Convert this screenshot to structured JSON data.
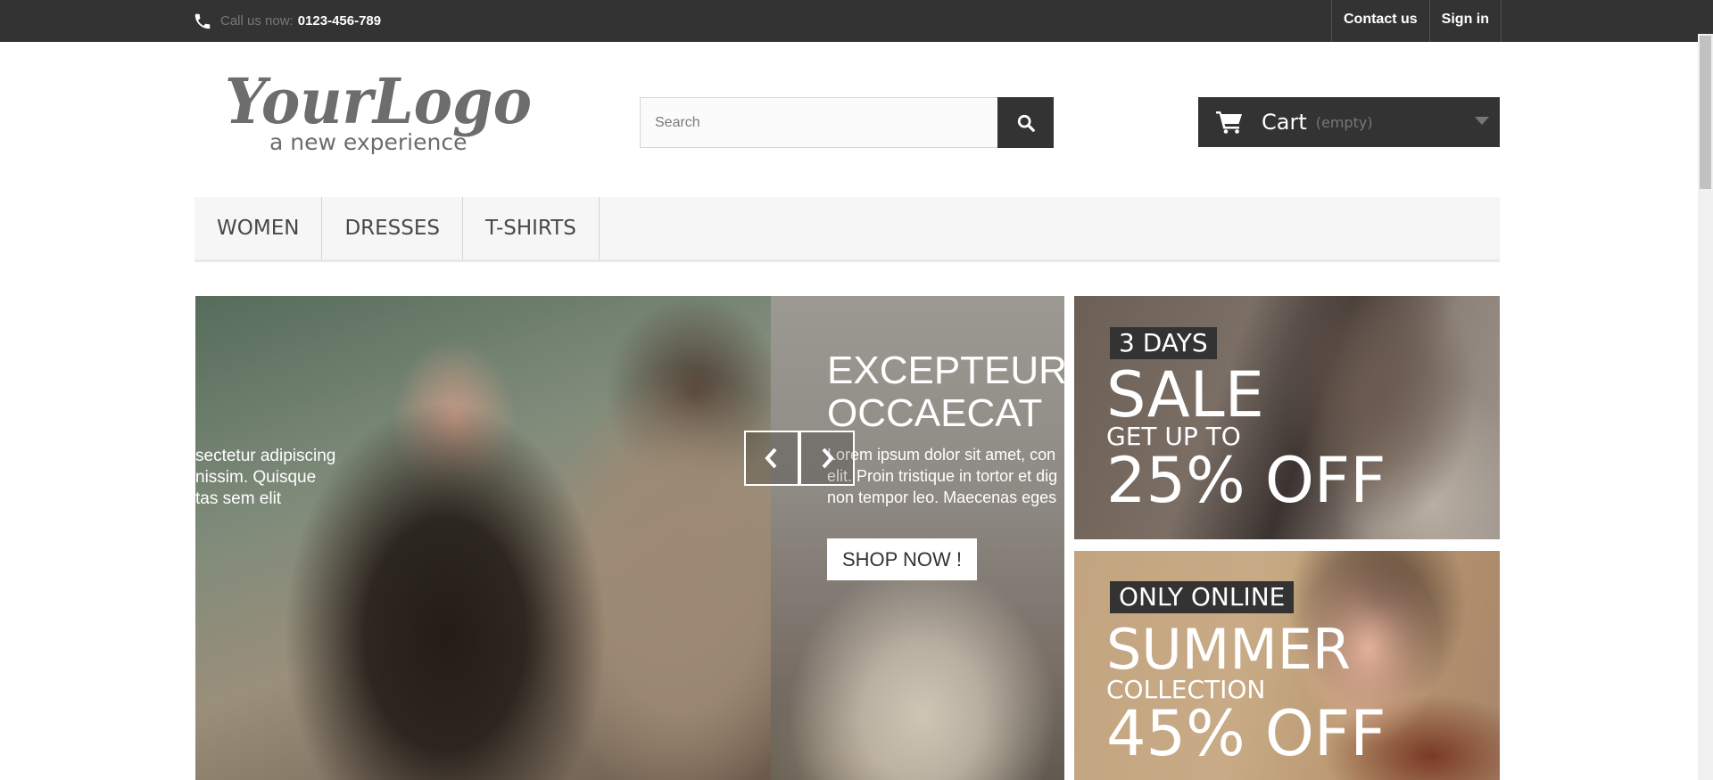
{
  "topbar": {
    "phone_label": "Call us now:",
    "phone_number": "0123-456-789",
    "links": [
      "Contact us",
      "Sign in"
    ]
  },
  "header": {
    "logo_line1": "YourLogo",
    "logo_line2": "a new experience",
    "search": {
      "placeholder": "Search",
      "value": ""
    },
    "cart": {
      "title": "Cart",
      "state": "(empty)"
    }
  },
  "menu": {
    "items": [
      "WOMEN",
      "DRESSES",
      "T-SHIRTS"
    ]
  },
  "slider": {
    "partial_text_lines": [
      "sectetur adipiscing",
      "nissim. Quisque",
      "tas sem elit"
    ],
    "title_lines": [
      "EXCEPTEUR",
      "OCCAECAT"
    ],
    "text_lines": [
      "Lorem ipsum dolor sit amet, con",
      "elit. Proin tristique in tortor et dig",
      "non tempor leo. Maecenas eges"
    ],
    "button": "SHOP NOW !"
  },
  "banners": [
    {
      "tag": "3 DAYS",
      "line1": "SALE",
      "line2": "GET UP TO",
      "line3": "25% OFF"
    },
    {
      "tag": "ONLY ONLINE",
      "line1": "SUMMER",
      "line2": "COLLECTION",
      "line3": "45% OFF"
    }
  ],
  "colors": {
    "dark": "#333333",
    "menu_bg": "#f6f6f6",
    "muted": "#777777"
  }
}
